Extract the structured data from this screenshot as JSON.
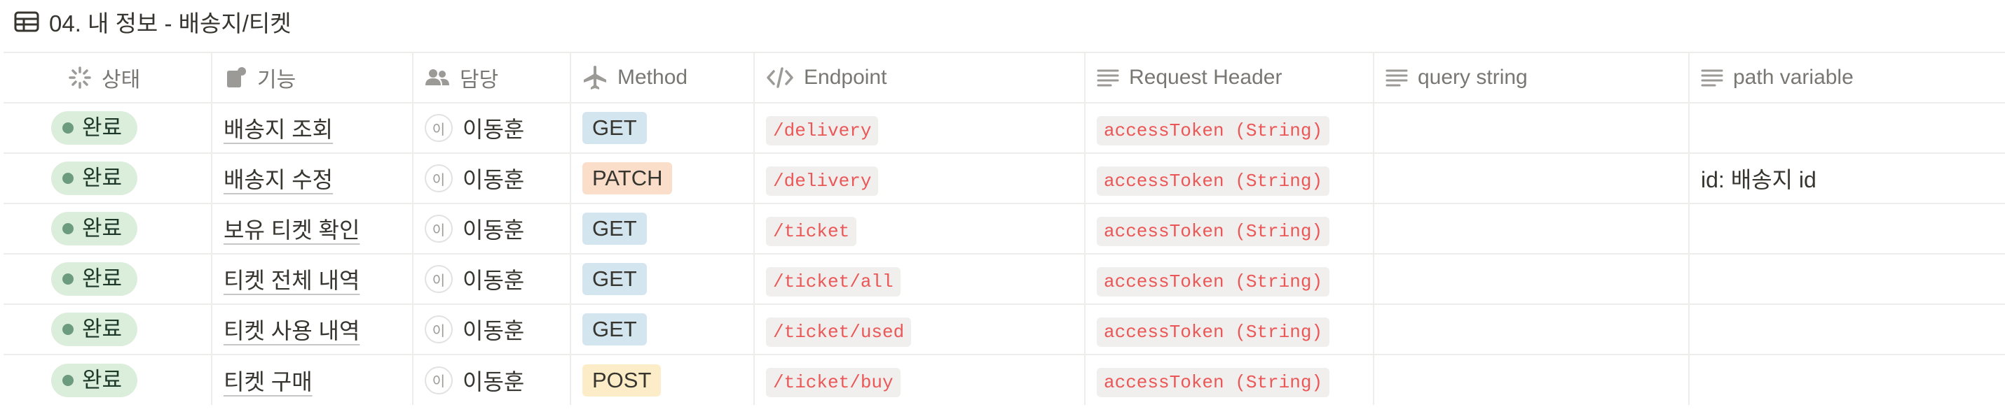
{
  "page": {
    "title": "04. 내 정보 - 배송지/티켓"
  },
  "columns": {
    "status": "상태",
    "feature": "기능",
    "assignee": "담당",
    "method": "Method",
    "endpoint": "Endpoint",
    "request_header": "Request Header",
    "query_string": "query string",
    "path_variable": "path variable"
  },
  "colors": {
    "status_done_bg": "#dbeddb",
    "status_done_dot": "#6c9b7d",
    "method_get_bg": "#d3e5ef",
    "method_patch_bg": "#fadec9",
    "method_post_bg": "#fdecc8",
    "code_text": "#eb5757"
  },
  "rows": [
    {
      "status": "완료",
      "feature": "배송지 조회",
      "avatar": "이",
      "assignee": "이동훈",
      "method": "GET",
      "method_color": "#d3e5ef",
      "endpoint": "/delivery",
      "request_header": "accessToken (String)",
      "query_string": "",
      "path_variable": ""
    },
    {
      "status": "완료",
      "feature": "배송지 수정",
      "avatar": "이",
      "assignee": "이동훈",
      "method": "PATCH",
      "method_color": "#fadec9",
      "endpoint": "/delivery",
      "request_header": "accessToken (String)",
      "query_string": "",
      "path_variable": "id: 배송지 id"
    },
    {
      "status": "완료",
      "feature": "보유 티켓 확인",
      "avatar": "이",
      "assignee": "이동훈",
      "method": "GET",
      "method_color": "#d3e5ef",
      "endpoint": "/ticket",
      "request_header": "accessToken (String)",
      "query_string": "",
      "path_variable": ""
    },
    {
      "status": "완료",
      "feature": "티켓 전체 내역",
      "avatar": "이",
      "assignee": "이동훈",
      "method": "GET",
      "method_color": "#d3e5ef",
      "endpoint": "/ticket/all",
      "request_header": "accessToken (String)",
      "query_string": "",
      "path_variable": ""
    },
    {
      "status": "완료",
      "feature": "티켓 사용 내역",
      "avatar": "이",
      "assignee": "이동훈",
      "method": "GET",
      "method_color": "#d3e5ef",
      "endpoint": "/ticket/used",
      "request_header": "accessToken (String)",
      "query_string": "",
      "path_variable": ""
    },
    {
      "status": "완료",
      "feature": "티켓 구매",
      "avatar": "이",
      "assignee": "이동훈",
      "method": "POST",
      "method_color": "#fdecc8",
      "endpoint": "/ticket/buy",
      "request_header": "accessToken (String)",
      "query_string": "",
      "path_variable": ""
    }
  ]
}
